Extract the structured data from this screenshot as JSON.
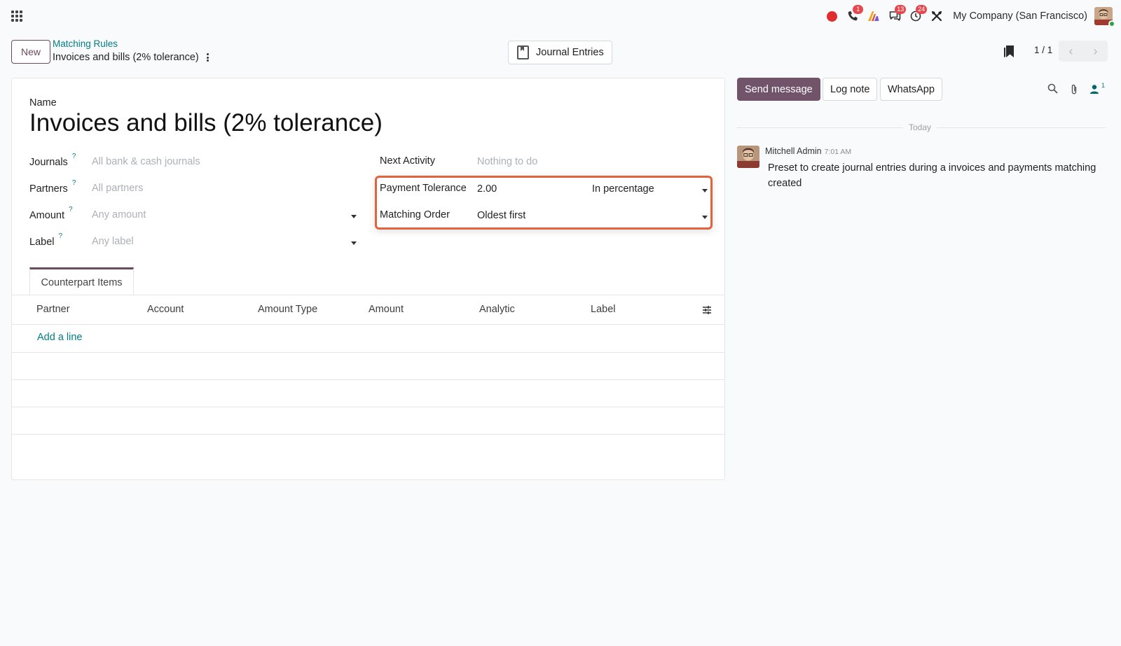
{
  "navbar": {
    "company": "My Company (San Francisco)",
    "badges": {
      "calls": "1",
      "messages": "13",
      "activities": "24"
    },
    "icons": [
      "apps-icon",
      "recording-icon",
      "phone-icon",
      "a-logo-icon",
      "chat-icon",
      "clock-icon",
      "tools-icon"
    ]
  },
  "control_panel": {
    "new_label": "New",
    "breadcrumb_parent": "Matching Rules",
    "breadcrumb_current": "Invoices and bills (2% tolerance)",
    "smart_button": "Journal Entries",
    "pager": "1 / 1"
  },
  "form": {
    "name_label": "Name",
    "name_value": "Invoices and bills (2% tolerance)",
    "journals_label": "Journals",
    "journals_placeholder": "All bank & cash journals",
    "partners_label": "Partners",
    "partners_placeholder": "All partners",
    "amount_label": "Amount",
    "amount_placeholder": "Any amount",
    "label_label": "Label",
    "label_placeholder": "Any label",
    "help_mark": "?",
    "next_activity_label": "Next Activity",
    "next_activity_placeholder": "Nothing to do",
    "payment_tolerance_label": "Payment Tolerance",
    "payment_tolerance_value": "2.00",
    "payment_tolerance_type": "In percentage",
    "matching_order_label": "Matching Order",
    "matching_order_value": "Oldest first"
  },
  "notebook": {
    "tab_label": "Counterpart Items",
    "columns": [
      "Partner",
      "Account",
      "Amount Type",
      "Amount",
      "Analytic",
      "Label"
    ],
    "add_line": "Add a line"
  },
  "chatter": {
    "send_message": "Send message",
    "log_note": "Log note",
    "whatsapp": "WhatsApp",
    "followers_count": "1",
    "date_separator": "Today",
    "message": {
      "author": "Mitchell Admin",
      "time": "7:01 AM",
      "body": "Preset to create journal entries during a invoices and payments matching created"
    }
  },
  "colors": {
    "brand": "#71536a",
    "link": "#017e84",
    "highlight": "#e1633f",
    "badge": "#e5484d"
  }
}
